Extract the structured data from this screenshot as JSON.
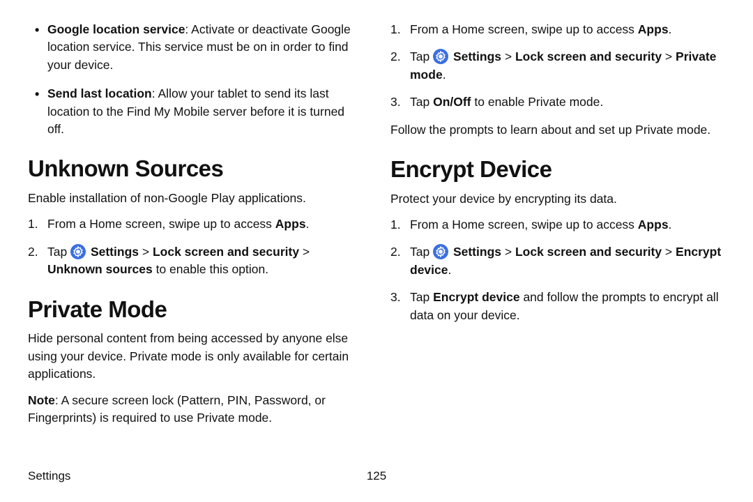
{
  "colors": {
    "icon_bg": "#3a6fe0",
    "icon_fg": "#ffffff"
  },
  "left": {
    "bullets": [
      {
        "title": "Google location service",
        "title_suffix": ": Activate or deactivate Google location service. This service must be on in order to find your device."
      },
      {
        "title": "Send last location",
        "title_suffix": ": Allow your tablet to send its last location to the Find My Mobile server before it is turned off."
      }
    ],
    "unknown_heading": "Unknown Sources",
    "unknown_intro": "Enable installation of non-Google Play applications.",
    "unknown_steps": {
      "s1_prefix": "From a Home screen, swipe up to access ",
      "s1_bold": "Apps",
      "s1_suffix": ".",
      "s2_prefix": "Tap ",
      "s2_b1": "Settings",
      "s2_sep1": " > ",
      "s2_b2": "Lock screen and security",
      "s2_sep2": " > ",
      "s2_b3": "Unknown sources",
      "s2_suffix": " to enable this option."
    },
    "private_heading": "Private Mode",
    "private_intro": "Hide personal content from being accessed by anyone else using your device. Private mode is only available for certain applications.",
    "private_note_label": "Note",
    "private_note_rest": ": A secure screen lock (Pattern, PIN, Password, or Fingerprints) is required to use Private mode."
  },
  "right": {
    "private_steps": {
      "s1_prefix": "From a Home screen, swipe up to access ",
      "s1_bold": "Apps",
      "s1_suffix": ".",
      "s2_prefix": "Tap ",
      "s2_b1": "Settings",
      "s2_sep1": " > ",
      "s2_b2": "Lock screen and security",
      "s2_sep2": " > ",
      "s2_b3": "Private mode",
      "s2_suffix": ".",
      "s3_prefix": "Tap ",
      "s3_bold": "On/Off",
      "s3_suffix": " to enable Private mode."
    },
    "private_followup": "Follow the prompts to learn about and set up Private mode.",
    "encrypt_heading": "Encrypt Device",
    "encrypt_intro": "Protect your device by encrypting its data.",
    "encrypt_steps": {
      "s1_prefix": "From a Home screen, swipe up to access ",
      "s1_bold": "Apps",
      "s1_suffix": ".",
      "s2_prefix": "Tap ",
      "s2_b1": "Settings",
      "s2_sep1": " > ",
      "s2_b2": "Lock screen and security",
      "s2_sep2": " > ",
      "s2_b3": "Encrypt device",
      "s2_suffix": ".",
      "s3_prefix": "Tap ",
      "s3_bold": "Encrypt device",
      "s3_suffix": " and follow the prompts to encrypt all data on your device."
    }
  },
  "footer": {
    "section": "Settings",
    "page": "125"
  }
}
